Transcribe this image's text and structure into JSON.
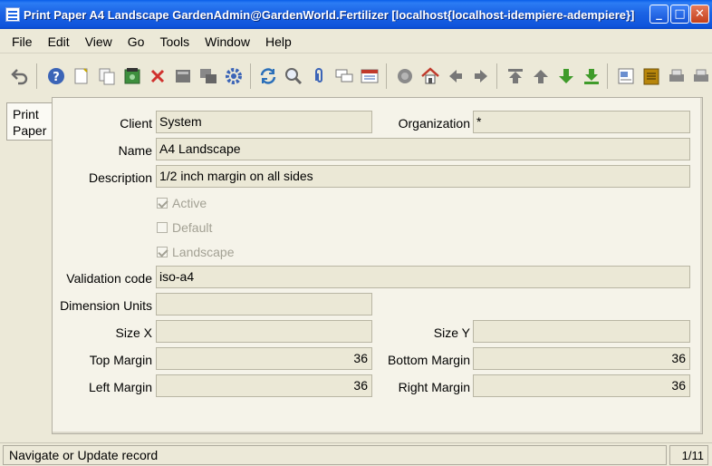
{
  "window": {
    "title": "Print Paper  A4 Landscape  GardenAdmin@GardenWorld.Fertilizer [localhost{localhost-idempiere-adempiere}]",
    "min_label": "_",
    "max_label": "□",
    "close_label": "✕"
  },
  "menu": [
    "File",
    "Edit",
    "View",
    "Go",
    "Tools",
    "Window",
    "Help"
  ],
  "toolbar_icons": [
    "undo-icon",
    "help-icon",
    "new-record-icon",
    "copy-record-icon",
    "save-icon",
    "delete-icon",
    "grid-toggle-icon",
    "multi-window-icon",
    "settings-icon",
    "refresh-icon",
    "find-icon",
    "attachment-icon",
    "chat-icon",
    "history-icon",
    "archive-icon",
    "home-icon",
    "back-icon",
    "forward-icon",
    "first-record-icon",
    "previous-record-icon",
    "next-record-icon",
    "last-record-icon",
    "report-icon",
    "archive-view-icon",
    "print-preview-icon",
    "print-icon"
  ],
  "tab": {
    "label_line1": "Print",
    "label_line2": "Paper"
  },
  "form": {
    "client_label": "Client",
    "client_value": "System",
    "organization_label": "Organization",
    "organization_value": "*",
    "name_label": "Name",
    "name_value": "A4 Landscape",
    "description_label": "Description",
    "description_value": "1/2 inch margin on all sides",
    "active_label": "Active",
    "active_checked": true,
    "default_label": "Default",
    "default_checked": false,
    "landscape_label": "Landscape",
    "landscape_checked": true,
    "validation_label": "Validation code",
    "validation_value": "iso-a4",
    "dimension_label": "Dimension Units",
    "dimension_value": "",
    "sizex_label": "Size X",
    "sizex_value": "",
    "sizey_label": "Size Y",
    "sizey_value": "",
    "top_label": "Top Margin",
    "top_value": "36",
    "bottom_label": "Bottom Margin",
    "bottom_value": "36",
    "left_label": "Left Margin",
    "left_value": "36",
    "right_label": "Right Margin",
    "right_value": "36"
  },
  "status": {
    "text": "Navigate or Update record",
    "count": "1/11"
  }
}
